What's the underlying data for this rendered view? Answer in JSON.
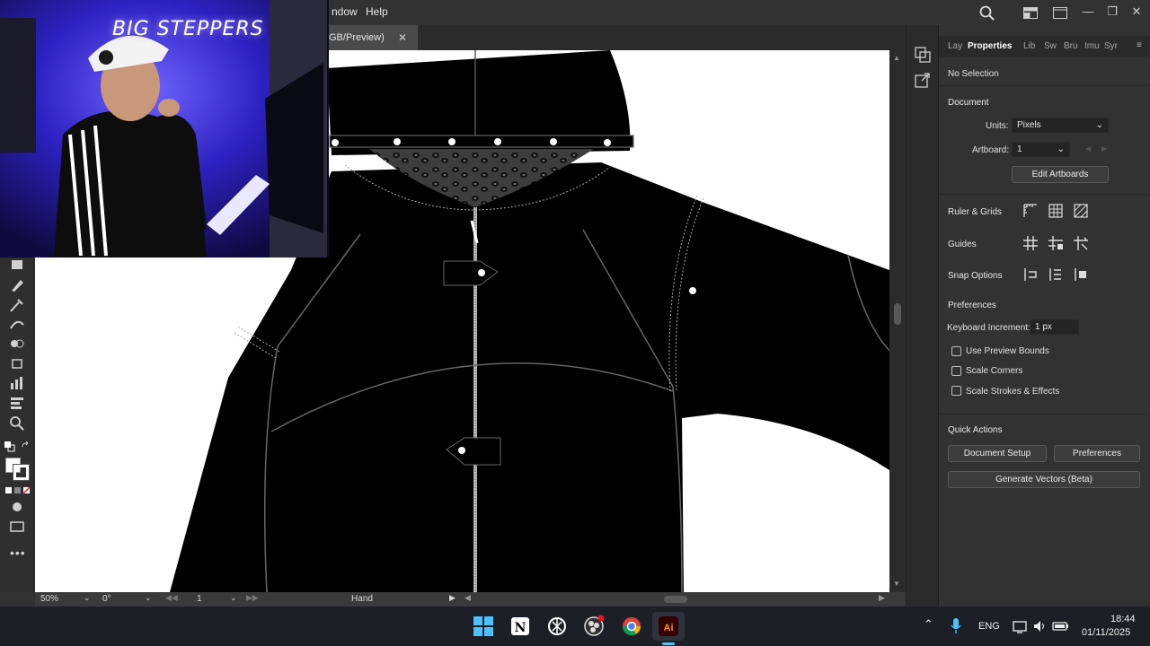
{
  "app": {
    "menu": [
      "ndow",
      "Help"
    ],
    "document_tab": {
      "title": "GB/Preview)"
    }
  },
  "webcam": {
    "sign_text": "BIG STEPPERS"
  },
  "status_bar": {
    "zoom": "50%",
    "rotation": "0°",
    "artboard": "1",
    "tool": "Hand"
  },
  "panel": {
    "tabs": [
      "Lay",
      "Properties",
      "Lib",
      "Sw",
      "Bru",
      "Imu",
      "Syr"
    ],
    "active_tab": "Properties",
    "selection": "No Selection",
    "document": {
      "title": "Document",
      "units_label": "Units:",
      "units_value": "Pixels",
      "artboard_label": "Artboard:",
      "artboard_value": "1",
      "edit_artboards": "Edit Artboards"
    },
    "ruler_grids": "Ruler & Grids",
    "guides": "Guides",
    "snap_options": "Snap Options",
    "preferences": {
      "title": "Preferences",
      "keyboard_increment_label": "Keyboard Increment:",
      "keyboard_increment_value": "1 px",
      "checkboxes": [
        "Use Preview Bounds",
        "Scale Corners",
        "Scale Strokes & Effects"
      ]
    },
    "quick_actions": {
      "title": "Quick Actions",
      "document_setup": "Document Setup",
      "preferences": "Preferences",
      "generate_vectors": "Generate Vectors (Beta)"
    }
  },
  "taskbar": {
    "language": "ENG",
    "time": "18:44",
    "date": "01/11/2025",
    "icons": [
      "windows-start",
      "notion",
      "chatgpt",
      "obs",
      "chrome",
      "illustrator"
    ]
  },
  "colors": {
    "app_bg": "#323232",
    "canvas": "#ffffff",
    "garment": "#000000",
    "webcam_glow": "#3a2cff",
    "illustrator_brand": "#ff9a00"
  }
}
